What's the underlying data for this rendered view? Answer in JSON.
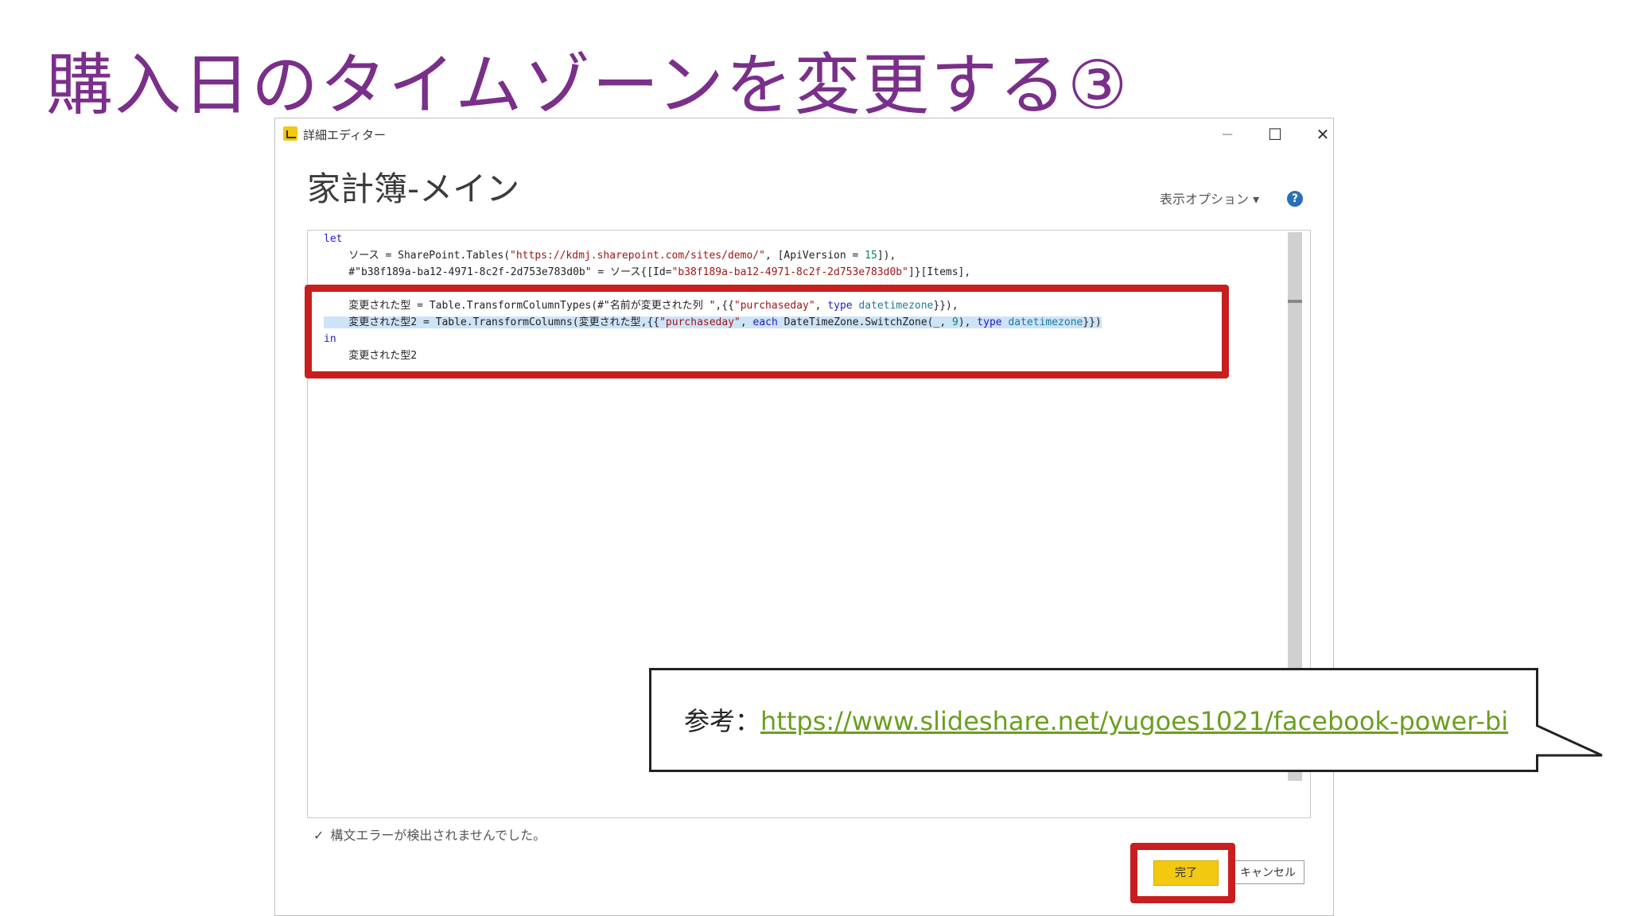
{
  "slide": {
    "title": "購入日のタイムゾーンを変更する③"
  },
  "window": {
    "title": "詳細エディター",
    "minimize": "─",
    "maximize": "☐",
    "close": "✕"
  },
  "editor": {
    "query_name": "家計簿-メイン",
    "view_options": "表示オプション ▾",
    "help": "?",
    "code_lines": [
      [
        {
          "t": "let",
          "c": "kw"
        }
      ],
      [
        {
          "t": "    ソース = SharePoint.Tables("
        },
        {
          "t": "\"https://kdmj.sharepoint.com/sites/demo/\"",
          "c": "str"
        },
        {
          "t": ", [ApiVersion = "
        },
        {
          "t": "15",
          "c": "num"
        },
        {
          "t": "]),"
        }
      ],
      [
        {
          "t": "    #\"b38f189a-ba12-4971-8c2f-2d753e783d0b\" = ソース{[Id="
        },
        {
          "t": "\"b38f189a-ba12-4971-8c2f-2d753e783d0b\"",
          "c": "str"
        },
        {
          "t": "]}[Items],"
        }
      ],
      [],
      [
        {
          "t": "    変更された型 = Table.TransformColumnTypes(#\"名前が変更された列 \",{{"
        },
        {
          "t": "\"purchaseday\"",
          "c": "str"
        },
        {
          "t": ", "
        },
        {
          "t": "type",
          "c": "kw"
        },
        {
          "t": " "
        },
        {
          "t": "datetimezone",
          "c": "type"
        },
        {
          "t": "}}),"
        }
      ],
      [
        {
          "t": "    変更された型2 = Table.TransformColumns(変更された型,{{",
          "h": true
        },
        {
          "t": "\"purchaseday\"",
          "c": "str",
          "h": true
        },
        {
          "t": ", ",
          "h": true
        },
        {
          "t": "each",
          "c": "kw",
          "h": true
        },
        {
          "t": " DateTimeZone.SwitchZone(_, ",
          "h": true
        },
        {
          "t": "9",
          "c": "num",
          "h": true
        },
        {
          "t": "), ",
          "h": true
        },
        {
          "t": "type",
          "c": "kw",
          "h": true
        },
        {
          "t": " ",
          "h": true
        },
        {
          "t": "datetimezone",
          "c": "type",
          "h": true
        },
        {
          "t": "}})",
          "h": true
        }
      ],
      [
        {
          "t": "in",
          "c": "kw"
        }
      ],
      [
        {
          "t": "    変更された型2"
        }
      ]
    ]
  },
  "status": {
    "check": "✓",
    "message": "構文エラーが検出されませんでした。"
  },
  "buttons": {
    "ok": "完了",
    "cancel": "キャンセル"
  },
  "callout": {
    "prefix": "参考：",
    "link": "https://www.slideshare.net/yugoes1021/facebook-power-bi"
  },
  "colors": {
    "title": "#7a2f8a",
    "highlight_box": "#c81e1e",
    "ok_button": "#f2c811",
    "link": "#6a9f1f"
  }
}
